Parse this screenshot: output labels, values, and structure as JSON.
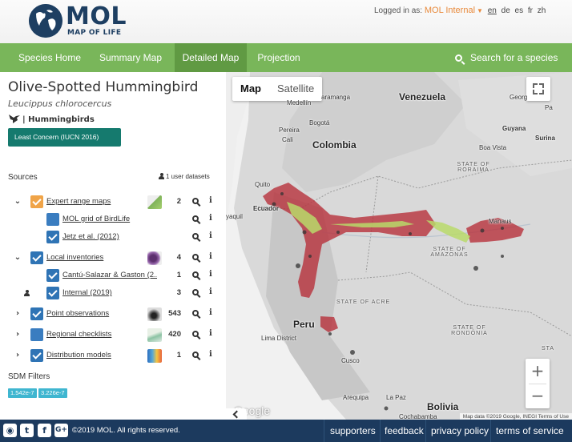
{
  "header": {
    "logo_text": "MOL",
    "logo_subtitle": "MAP OF LIFE",
    "logged_in_prefix": "Logged in as:",
    "user": "MOL Internal",
    "languages": [
      "en",
      "de",
      "es",
      "fr",
      "zh"
    ],
    "active_language": "en"
  },
  "nav": {
    "items": [
      {
        "label": "Species Home"
      },
      {
        "label": "Summary Map"
      },
      {
        "label": "Detailed Map",
        "active": true
      },
      {
        "label": "Projection"
      }
    ],
    "search_label": "Search for a species"
  },
  "species": {
    "common_name": "Olive-Spotted Hummingbird",
    "scientific_name": "Leucippus chlorocercus",
    "group": "| Hummingbirds",
    "iucn_status": "Least Concern (IUCN 2016)"
  },
  "sources": {
    "label": "Sources",
    "user_datasets": "1 user datasets",
    "rows": [
      {
        "label": "Expert range maps",
        "count": "2"
      },
      {
        "label": "MOL grid of BirdLife",
        "count": ""
      },
      {
        "label": "Jetz et al. (2012)",
        "count": ""
      },
      {
        "label": "Local inventories",
        "count": "4"
      },
      {
        "label": "Cantú-Salazar & Gaston (2...",
        "count": "1"
      },
      {
        "label": "Internal (2019)",
        "count": "3"
      },
      {
        "label": "Point observations",
        "count": "543"
      },
      {
        "label": "Regional checklists",
        "count": "420"
      },
      {
        "label": "Distribution models",
        "count": "1"
      }
    ]
  },
  "sdm": {
    "label": "SDM Filters",
    "chips": [
      "1.542e-7",
      "3.226e-7"
    ]
  },
  "map": {
    "type_buttons": [
      "Map",
      "Satellite"
    ],
    "selected_type": "Map",
    "places": {
      "venezuela": "Venezuela",
      "colombia": "Colombia",
      "peru": "Peru",
      "bolivia": "Bolivia",
      "medellin": "Medellín",
      "bogota": "Bogotá",
      "pereira": "Pereira",
      "cali": "Cali",
      "quito": "Quito",
      "ecuador": "Ecuador",
      "guayaquil": "yaquil",
      "manaus": "Manaus",
      "guyana": "Guyana",
      "boa_vista": "Boa Vista",
      "suriname": "Surina",
      "georgetown": "Georg",
      "maracaibo_fragment": "aramanga",
      "pa_fragment": "Pa",
      "roraima": "STATE OF RORAIMA",
      "amazonas": "STATE OF AMAZONAS",
      "acre": "STATE OF ACRE",
      "rondonia": "STATE OF RONDÔNIA",
      "sta": "STA",
      "lima": "Lima District",
      "cusco": "Cusco",
      "arequipa": "Arequipa",
      "lapaz": "La Paz",
      "cochabamba": "Cochabamba"
    },
    "google_label": "Google",
    "attribution": "Map data ©2019 Google, INEGI   Terms of Use"
  },
  "footer": {
    "social": [
      "github",
      "twitter",
      "facebook",
      "google-plus"
    ],
    "copyright": "©2019 MOL. All rights reserved.",
    "links": [
      "supporters",
      "feedback",
      "privacy policy",
      "terms of service"
    ]
  },
  "colors": {
    "nav_green": "#79b65a",
    "nav_active": "#609a43",
    "footer_navy": "#1c3a5e",
    "iucn_teal": "#157a6e",
    "checkbox_blue": "#2f74b5",
    "checkbox_orange": "#f0a448",
    "range_red": "#b7313b",
    "range_green": "#b9d96a"
  }
}
